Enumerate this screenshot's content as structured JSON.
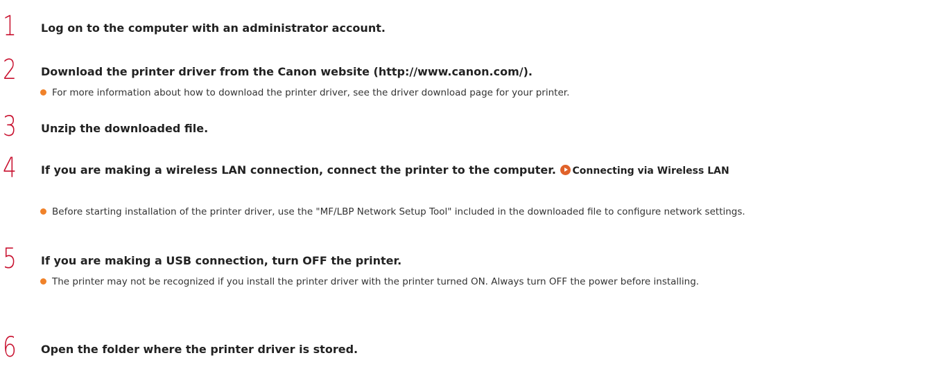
{
  "steps": [
    {
      "number": "1",
      "title": "Log on to the computer with an administrator account."
    },
    {
      "number": "2",
      "title": "Download the printer driver from the Canon website (http://www.canon.com/).",
      "note": "For more information about how to download the printer driver, see the driver download page for your printer."
    },
    {
      "number": "3",
      "title": "Unzip the downloaded file."
    },
    {
      "number": "4",
      "title": "If you are making a wireless LAN connection, connect the printer to the computer.",
      "link": "Connecting via Wireless LAN",
      "link_icon": "arrow-circle-icon",
      "note": "Before starting installation of the printer driver, use the \"MF/LBP Network Setup Tool\" included in the downloaded file to configure network settings."
    },
    {
      "number": "5",
      "title": "If you are making a USB connection, turn OFF the printer.",
      "note": "The printer may not be recognized if you install the printer driver with the printer turned ON. Always turn OFF the power before installing."
    },
    {
      "number": "6",
      "title": "Open the folder where the printer driver is stored."
    }
  ],
  "colors": {
    "step_number": "#c8102e",
    "bullet": "#f0822a",
    "link_icon": "#e0622a",
    "text": "#222222"
  }
}
